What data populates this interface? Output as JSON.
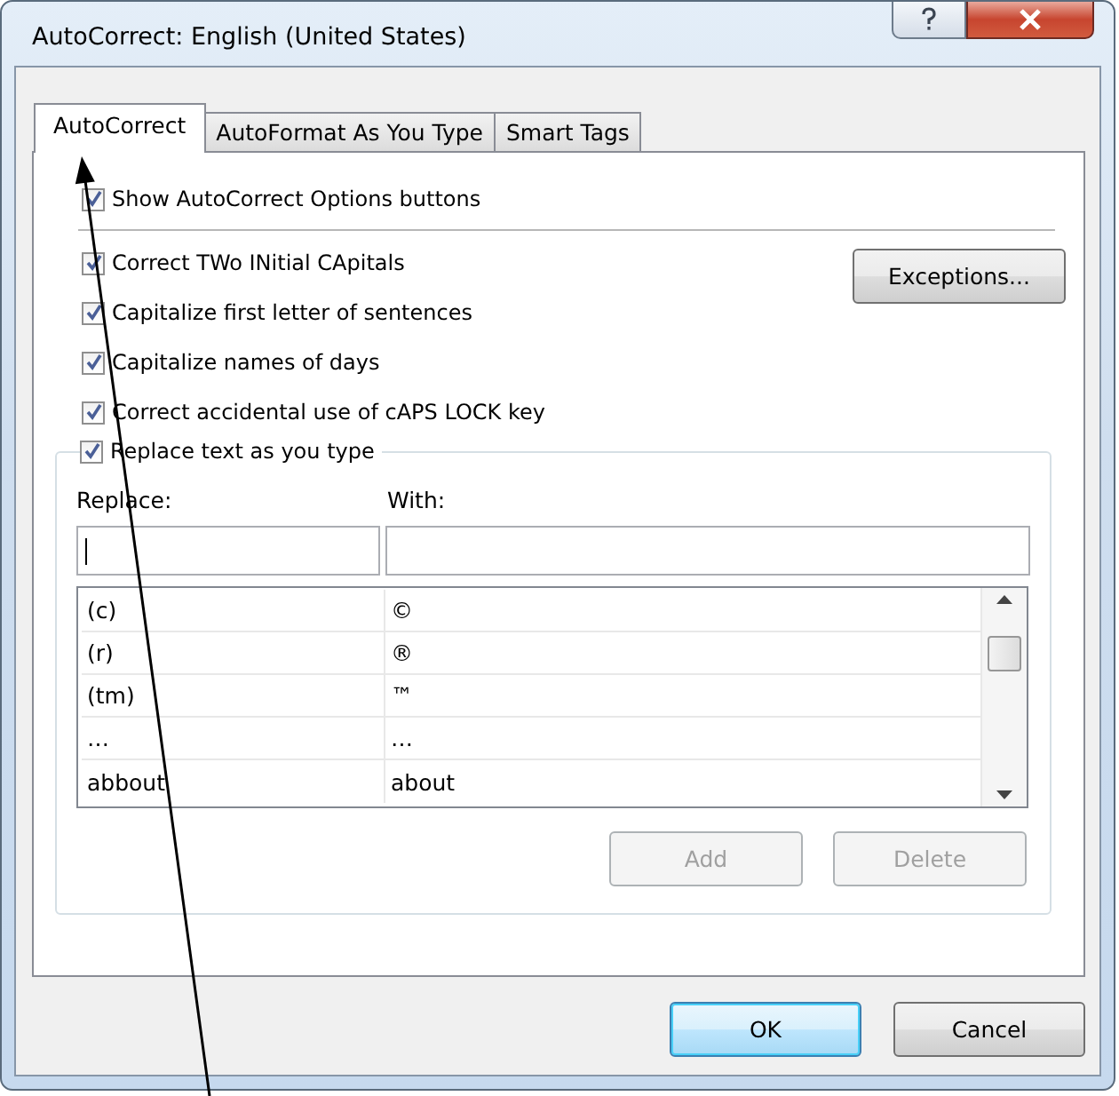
{
  "window": {
    "title": "AutoCorrect: English (United States)"
  },
  "tabs": [
    {
      "label": "AutoCorrect",
      "selected": true
    },
    {
      "label": "AutoFormat As You Type",
      "selected": false
    },
    {
      "label": "Smart Tags",
      "selected": false
    }
  ],
  "show_options": {
    "label": "Show AutoCorrect Options buttons",
    "checked": true
  },
  "options": [
    {
      "label": "Correct TWo INitial CApitals",
      "checked": true
    },
    {
      "label": "Capitalize first letter of sentences",
      "checked": true
    },
    {
      "label": "Capitalize names of days",
      "checked": true
    },
    {
      "label": "Correct accidental use of cAPS LOCK key",
      "checked": true
    }
  ],
  "exceptions_button": "Exceptions...",
  "replace_group": {
    "label": "Replace text as you type",
    "checked": true,
    "replace_label": "Replace:",
    "with_label": "With:",
    "entries": [
      {
        "replace": "(c)",
        "with": "©"
      },
      {
        "replace": "(r)",
        "with": "®"
      },
      {
        "replace": "(tm)",
        "with": "™"
      },
      {
        "replace": "…",
        "with": "…"
      },
      {
        "replace": "abbout",
        "with": "about"
      }
    ],
    "buttons": [
      {
        "label": "Add",
        "disabled": true
      },
      {
        "label": "Delete",
        "disabled": true
      }
    ]
  },
  "dialog_buttons": [
    {
      "label": "OK",
      "default": true
    },
    {
      "label": "Cancel",
      "default": false
    }
  ]
}
